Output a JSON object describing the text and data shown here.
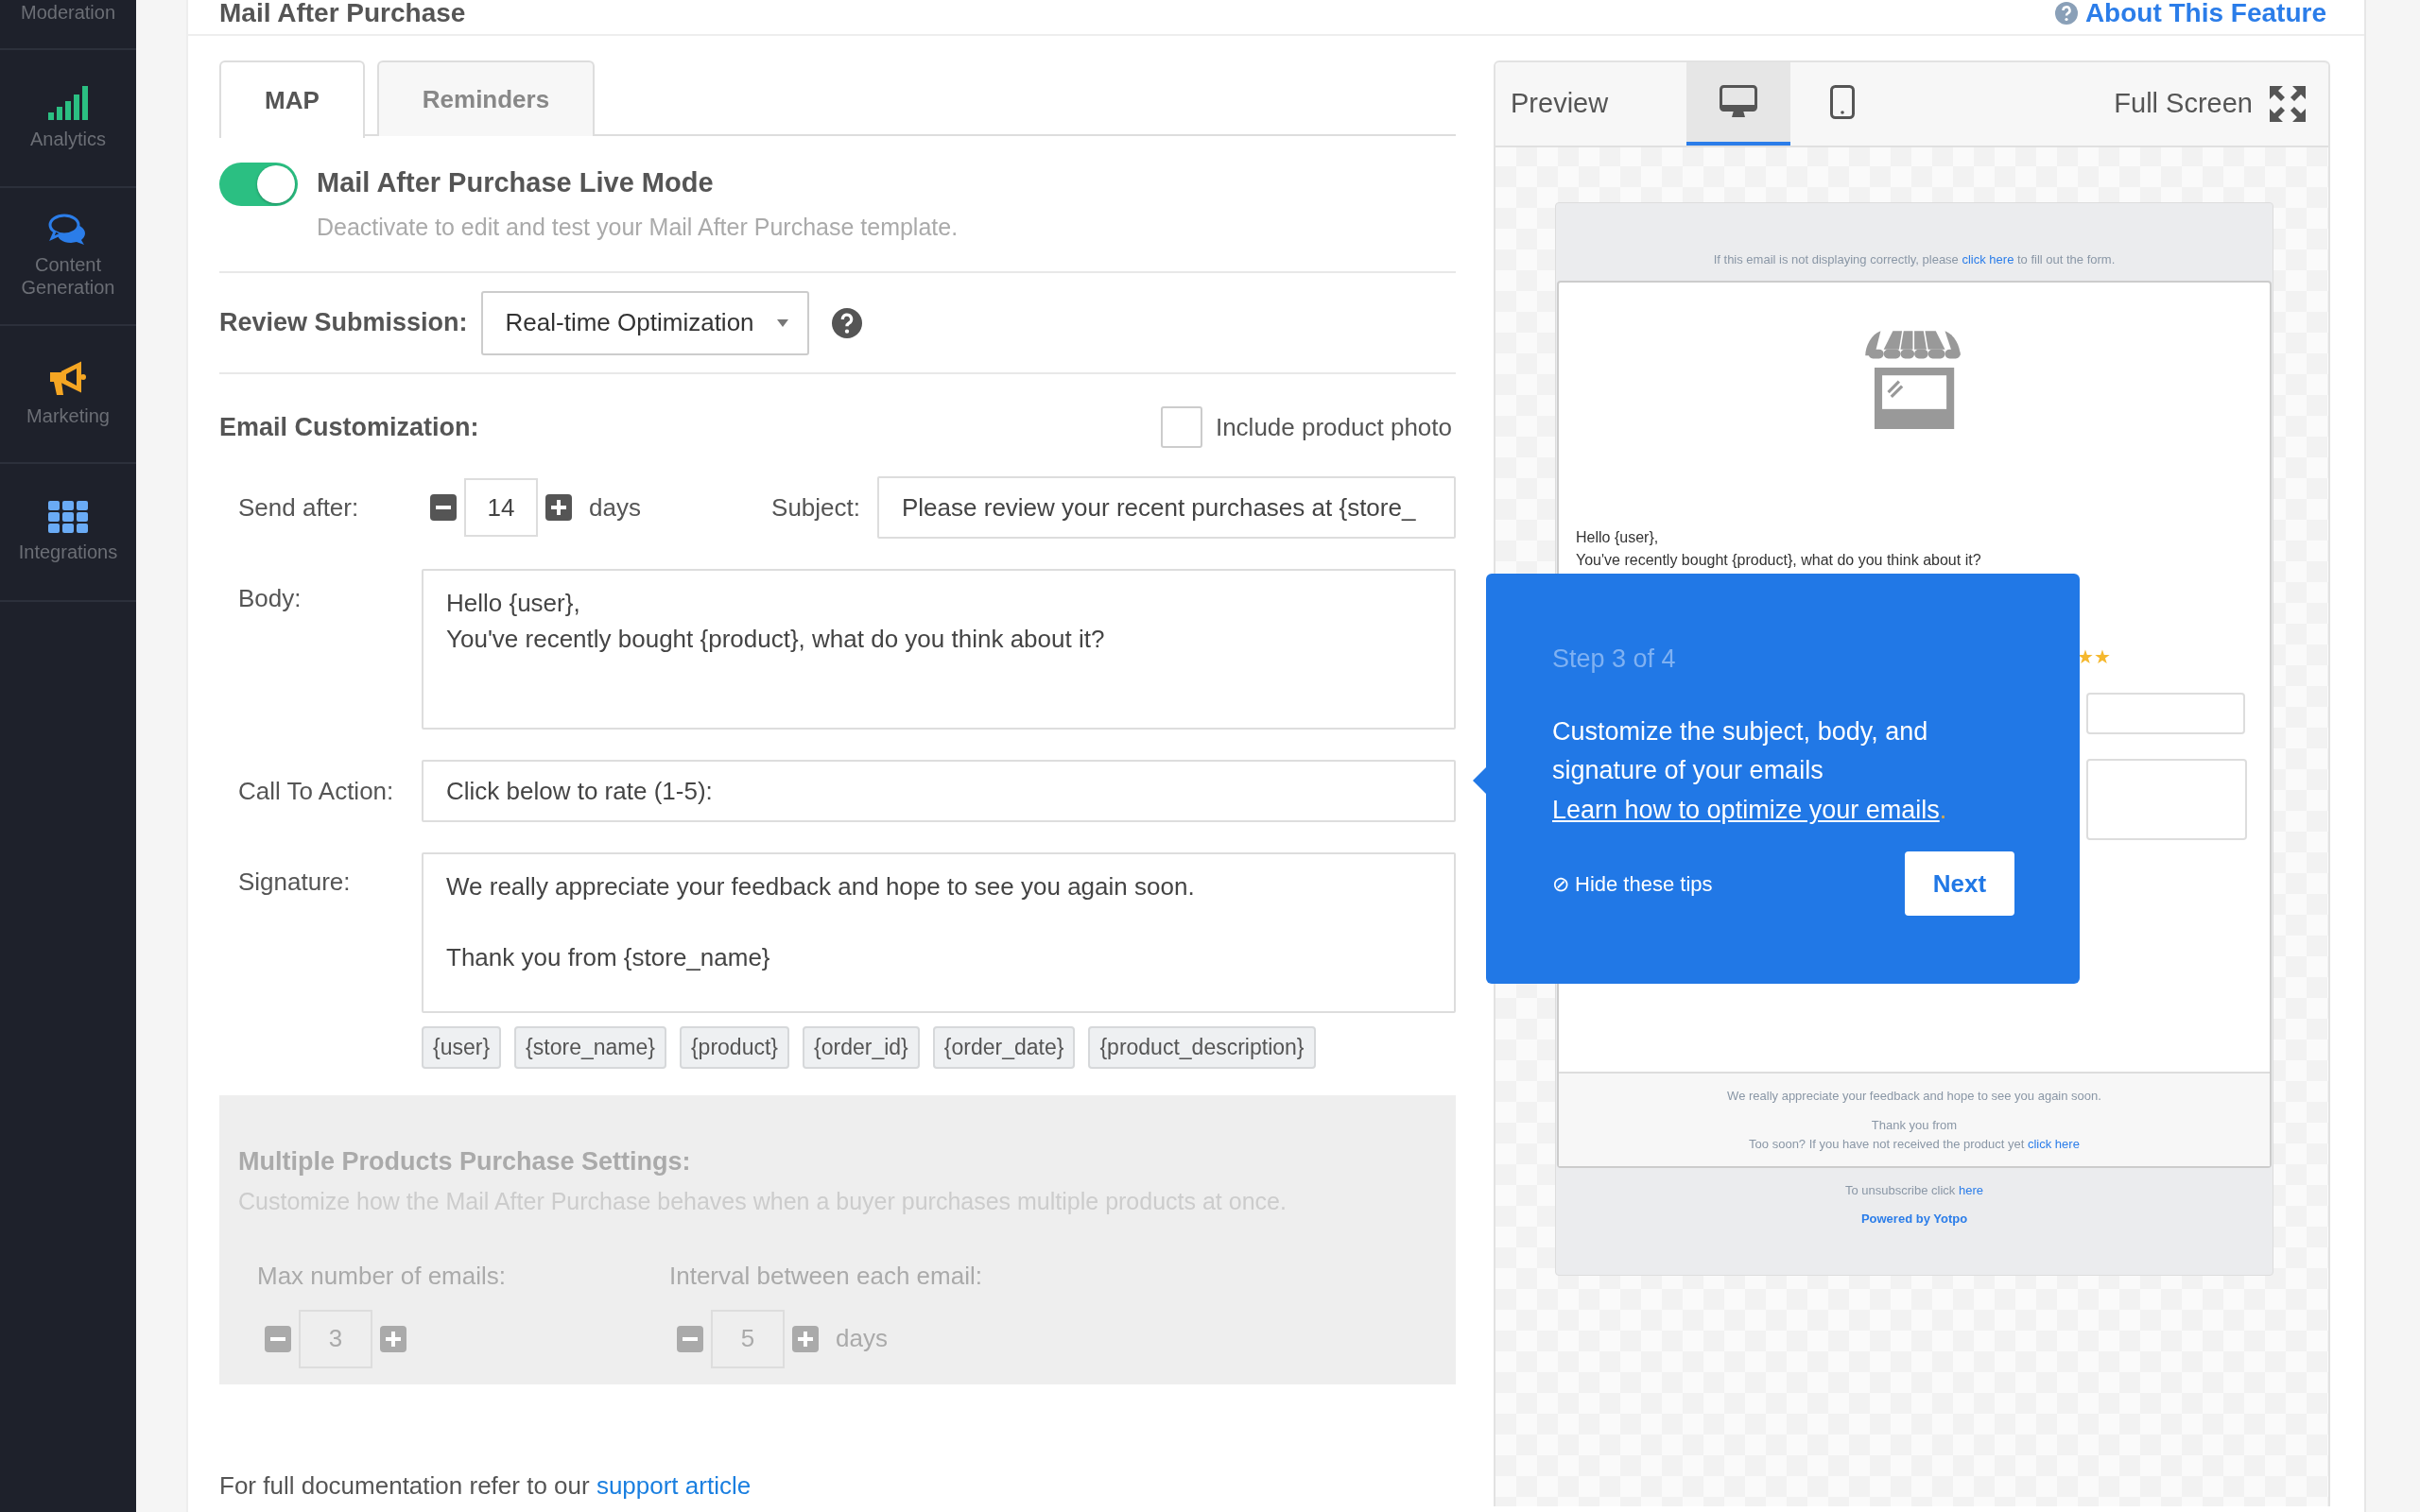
{
  "sidebar": {
    "items": [
      {
        "label": "Moderation"
      },
      {
        "label": "Analytics"
      },
      {
        "label": "Content Generation"
      },
      {
        "label": "Marketing"
      },
      {
        "label": "Integrations"
      }
    ]
  },
  "page": {
    "title": "Mail After Purchase",
    "help_link": "About This Feature"
  },
  "tabs": [
    {
      "label": "MAP",
      "selected": true
    },
    {
      "label": "Reminders",
      "selected": false
    }
  ],
  "live_mode": {
    "on": true,
    "title": "Mail After Purchase Live Mode",
    "description": "Deactivate to edit and test your Mail After Purchase template."
  },
  "review_submission": {
    "label": "Review Submission:",
    "value": "Real-time Optimization"
  },
  "email_customization": {
    "heading": "Email Customization:",
    "include_photo": {
      "label": "Include product photo",
      "checked": false
    },
    "send_after": {
      "label": "Send after:",
      "value": "14",
      "unit": "days"
    },
    "subject": {
      "label": "Subject:",
      "value": "Please review your recent purchases at {store_"
    },
    "body": {
      "label": "Body:",
      "lines": [
        "Hello {user},",
        "You've recently bought {product}, what do you think about it?"
      ]
    },
    "call_to_action": {
      "label": "Call To Action:",
      "value": "Click below to rate (1-5):"
    },
    "signature": {
      "label": "Signature:",
      "paragraphs": [
        "We really appreciate your feedback and hope to see you again soon.",
        "Thank you from {store_name}"
      ]
    },
    "tags": [
      "{user}",
      "{store_name}",
      "{product}",
      "{order_id}",
      "{order_date}",
      "{product_description}"
    ]
  },
  "multiple_products": {
    "disabled": true,
    "heading": "Multiple Products Purchase Settings:",
    "description": "Customize how the Mail After Purchase behaves when a buyer purchases multiple products at once.",
    "max_emails": {
      "label": "Max number of emails:",
      "value": "3"
    },
    "interval": {
      "label": "Interval between each email:",
      "value": "5",
      "unit": "days"
    }
  },
  "footer": {
    "text": "For full documentation refer to our",
    "link": "support article"
  },
  "preview": {
    "title": "Preview",
    "devices": [
      {
        "kind": "desktop",
        "selected": true
      },
      {
        "kind": "tablet",
        "selected": false
      }
    ],
    "full_screen": "Full Screen",
    "email": {
      "notice_before": "If this email is not displaying correctly, please",
      "notice_link": "click here",
      "notice_after": "to fill out the form.",
      "greeting": "Hello {user},",
      "body": "You've recently bought {product}, what do you think about it?",
      "stars_text": "★★",
      "signature": "We really appreciate your feedback and hope to see you again soon.",
      "thanks": "Thank you from",
      "too_soon": "Too soon? If you have not received the product yet",
      "too_soon_link": "click here",
      "unsubscribe": "To unsubscribe click",
      "unsubscribe_link": "here",
      "powered": "Powered by Yotpo"
    }
  },
  "tooltip": {
    "step": "Step 3 of 4",
    "text": "Customize the subject, body, and signature of your emails",
    "link": "Learn how to optimize your emails",
    "link_suffix": ".",
    "hide_icon": "⊘",
    "hide": "Hide these tips",
    "next": "Next"
  }
}
